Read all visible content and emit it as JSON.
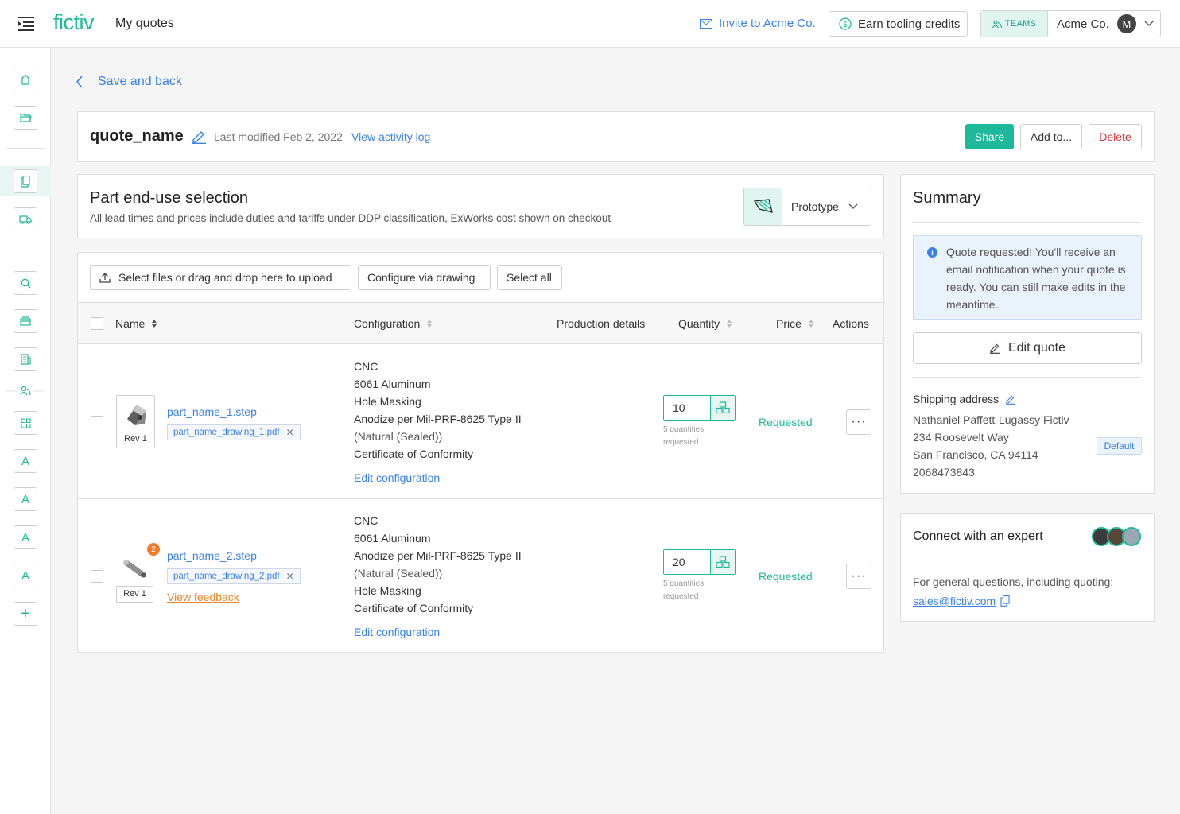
{
  "topbar": {
    "logo": "fictiv",
    "title": "My quotes",
    "invite_label": "Invite to Acme Co.",
    "earn_label": "Earn tooling credits",
    "teams_label": "TEAMS",
    "team_name": "Acme Co.",
    "avatar_initial": "M"
  },
  "sidebar": {
    "items": [
      "home-icon",
      "folder-icon",
      "quotes-icon",
      "truck-icon",
      "search-icon",
      "inbox-icon",
      "building-icon",
      "team-icon",
      "grid-icon",
      "team-a-1",
      "team-a-2",
      "team-a-3",
      "team-a-4",
      "add-icon"
    ],
    "letters": [
      "A",
      "A",
      "A",
      "A"
    ],
    "add": "+"
  },
  "back_label": "Save and back",
  "quote": {
    "name": "quote_name",
    "modified": "Last modified Feb 2, 2022",
    "activity_link": "View activity log",
    "share_label": "Share",
    "add_label": "Add to...",
    "delete_label": "Delete"
  },
  "end_use": {
    "title": "Part end-use selection",
    "subtitle": "All lead times and prices include duties and tariffs under DDP classification, ExWorks cost shown on checkout",
    "selected": "Prototype"
  },
  "toolbar": {
    "upload_label": "Select files or drag and drop here to upload",
    "configure_label": "Configure via drawing",
    "select_all_label": "Select all"
  },
  "table": {
    "columns": {
      "name": "Name",
      "configuration": "Configuration",
      "production": "Production details",
      "quantity": "Quantity",
      "price": "Price",
      "actions": "Actions"
    },
    "rows": [
      {
        "rev": "Rev 1",
        "file": "part_name_1.step",
        "drawing": "part_name_drawing_1.pdf",
        "config": [
          "CNC",
          "6061 Aluminum",
          "Hole Masking",
          "Anodize per Mil-PRF-8625 Type II",
          "(Natural (Sealed))",
          "Certificate of Conformity"
        ],
        "edit_config": "Edit configuration",
        "quantity": "10",
        "qty_note_1": "5 quantities",
        "qty_note_2": "requested",
        "price": "Requested",
        "more": "···"
      },
      {
        "rev": "Rev 1",
        "file": "part_name_2.step",
        "drawing": "part_name_drawing_2.pdf",
        "badge": "2",
        "feedback": "View feedback",
        "config": [
          "CNC",
          "6061 Aluminum",
          "Anodize per Mil-PRF-8625 Type II",
          "(Natural (Sealed))",
          "Hole Masking",
          "Certificate of Conformity"
        ],
        "edit_config": "Edit configuration",
        "quantity": "20",
        "qty_note_1": "5 quantities",
        "qty_note_2": "requested",
        "price": "Requested",
        "more": "···"
      }
    ]
  },
  "summary": {
    "title": "Summary",
    "info": "Quote requested! You'll receive an email notification when your quote is ready. You can still make edits in the meantime.",
    "edit_label": "Edit quote",
    "shipping_label": "Shipping address",
    "address": [
      "Nathaniel Paffett-Lugassy Fictiv",
      "234 Roosevelt Way",
      "San Francisco, CA 94114",
      "2068473843"
    ],
    "default_tag": "Default"
  },
  "expert": {
    "title": "Connect with an expert",
    "text": "For general questions, including quoting:",
    "email": "sales@fictiv.com"
  },
  "colors": {
    "brand": "#1db99a",
    "link": "#3a82e8",
    "danger": "#d33838",
    "warning": "#f07c2a"
  }
}
